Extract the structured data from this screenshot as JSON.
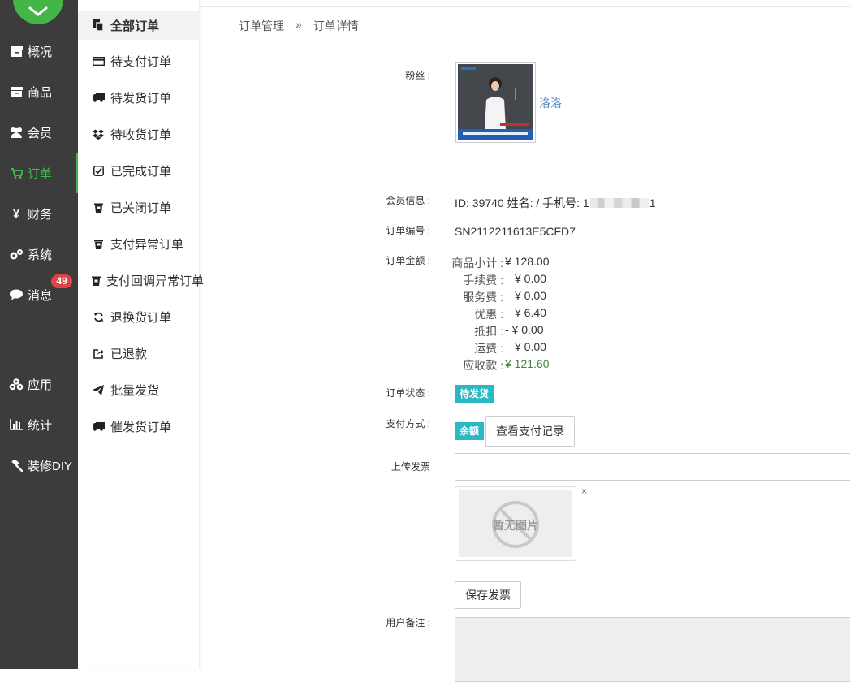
{
  "sidebar": {
    "items": [
      {
        "label": "概况",
        "icon": "archive-icon"
      },
      {
        "label": "商品",
        "icon": "archive-icon"
      },
      {
        "label": "会员",
        "icon": "users-icon"
      },
      {
        "label": "订单",
        "icon": "cart-icon",
        "active": true
      },
      {
        "label": "财务",
        "icon": "yen-icon"
      },
      {
        "label": "系统",
        "icon": "gears-icon"
      },
      {
        "label": "消息",
        "icon": "comment-icon",
        "badge": "49"
      },
      {
        "label": "应用",
        "icon": "cubes-icon"
      },
      {
        "label": "统计",
        "icon": "bar-chart-icon"
      },
      {
        "label": "装修DIY",
        "icon": "gavel-icon"
      }
    ],
    "accent": "#44b549",
    "bg": "#3c3c3c"
  },
  "subnav": {
    "items": [
      {
        "label": "全部订单",
        "icon": "copy-icon",
        "active": true
      },
      {
        "label": "待支付订单",
        "icon": "credit-card-icon"
      },
      {
        "label": "待发货订单",
        "icon": "truck-icon"
      },
      {
        "label": "待收货订单",
        "icon": "dropbox-icon"
      },
      {
        "label": "已完成订单",
        "icon": "check-square-icon"
      },
      {
        "label": "已关闭订单",
        "icon": "trash-icon"
      },
      {
        "label": "支付异常订单",
        "icon": "trash-icon"
      },
      {
        "label": "支付回调异常订单",
        "icon": "trash-icon"
      },
      {
        "label": "退换货订单",
        "icon": "refresh-icon"
      },
      {
        "label": "已退款",
        "icon": "share-square-icon"
      },
      {
        "label": "批量发货",
        "icon": "paper-plane-icon"
      },
      {
        "label": "催发货订单",
        "icon": "truck-icon"
      }
    ]
  },
  "breadcrumb": {
    "parent": "订单管理",
    "separator": "»",
    "current": "订单详情"
  },
  "detail": {
    "fan_label": "粉丝 :",
    "fan_name": "洛洛",
    "member_label": "会员信息 :",
    "member_info": "ID: 39740 姓名: / 手机号: 1",
    "member_phone_tail": "1",
    "order_no_label": "订单编号 :",
    "order_no": "SN2112211613E5CFD7",
    "amount_label": "订单金额 :",
    "amounts": [
      {
        "label": "商品小计 :",
        "value": "¥ 128.00"
      },
      {
        "label": "手续费 :",
        "value": "¥ 0.00"
      },
      {
        "label": "服务费 :",
        "value": "¥ 0.00"
      },
      {
        "label": "优惠 :",
        "value": "¥ 6.40"
      },
      {
        "label": "抵扣 :",
        "value": "- ¥ 0.00"
      },
      {
        "label": "运费 :",
        "value": "¥ 0.00"
      },
      {
        "label": "应收款 :",
        "value": "¥ 121.60",
        "highlight": true
      }
    ],
    "status_label": "订单状态 :",
    "status": "待发货",
    "pay_label": "支付方式 :",
    "pay_method": "余额",
    "pay_record_button": "查看支付记录",
    "invoice_label": "上传发票",
    "no_image_text": "暂无图片",
    "remove_icon": "×",
    "save_invoice_button": "保存发票",
    "remark_label": "用户备注 :"
  },
  "colors": {
    "tag": "#2bb8c5",
    "link": "#5a8fc6",
    "total": "#3a8a3a",
    "badge": "#e04444"
  }
}
